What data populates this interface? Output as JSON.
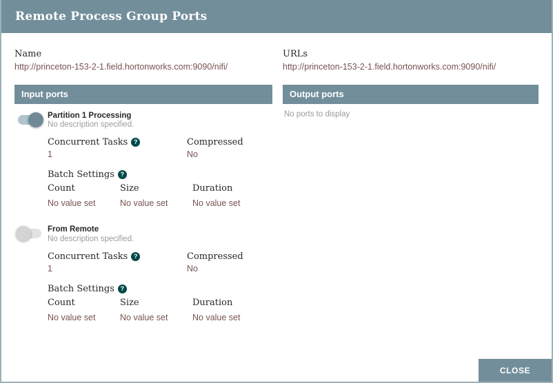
{
  "dialog": {
    "title": "Remote Process Group Ports",
    "close_label": "CLOSE"
  },
  "info": {
    "name": {
      "label": "Name",
      "value": "http://princeton-153-2-1.field.hortonworks.com:9090/nifi/"
    },
    "urls": {
      "label": "URLs",
      "value": "http://princeton-153-2-1.field.hortonworks.com:9090/nifi/"
    }
  },
  "input_ports": {
    "header": "Input ports",
    "ports": [
      {
        "name": "Partition 1 Processing",
        "description": "No description specified.",
        "enabled": true,
        "concurrent_tasks_label": "Concurrent Tasks",
        "concurrent_tasks_value": "1",
        "compressed_label": "Compressed",
        "compressed_value": "No",
        "batch_settings_label": "Batch Settings",
        "count_label": "Count",
        "count_value": "No value set",
        "size_label": "Size",
        "size_value": "No value set",
        "duration_label": "Duration",
        "duration_value": "No value set"
      },
      {
        "name": "From Remote",
        "description": "No description specified.",
        "enabled": false,
        "concurrent_tasks_label": "Concurrent Tasks",
        "concurrent_tasks_value": "1",
        "compressed_label": "Compressed",
        "compressed_value": "No",
        "batch_settings_label": "Batch Settings",
        "count_label": "Count",
        "count_value": "No value set",
        "size_label": "Size",
        "size_value": "No value set",
        "duration_label": "Duration",
        "duration_value": "No value set"
      }
    ]
  },
  "output_ports": {
    "header": "Output ports",
    "empty_message": "No ports to display"
  },
  "icons": {
    "help": "?"
  },
  "colors": {
    "header_bg": "#728e9b",
    "value_text": "#775351",
    "help_icon_bg": "#004849",
    "toggle_on_knob": "#6f8a96"
  }
}
